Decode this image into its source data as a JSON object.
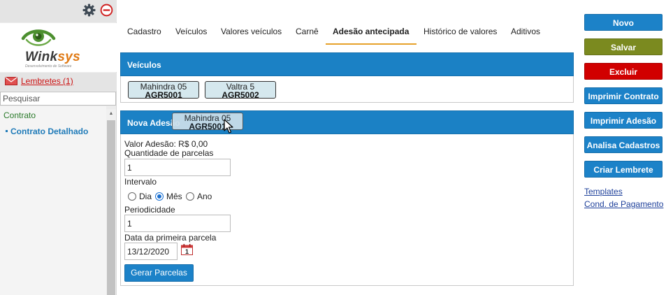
{
  "sidebar": {
    "logo": {
      "brand_prefix": "Wink",
      "brand_suffix": "sys",
      "tagline": "Desenvolvimento de Software"
    },
    "reminders_link": "Lembretes (1)",
    "search_placeholder": "Pesquisar",
    "nav_section": "Contrato",
    "nav_item": "Contrato Detalhado"
  },
  "tabs": [
    {
      "label": "Cadastro",
      "active": false
    },
    {
      "label": "Veículos",
      "active": false
    },
    {
      "label": "Valores veículos",
      "active": false
    },
    {
      "label": "Carnê",
      "active": false
    },
    {
      "label": "Adesão antecipada",
      "active": true
    },
    {
      "label": "Histórico de valores",
      "active": false
    },
    {
      "label": "Aditivos",
      "active": false
    }
  ],
  "vehicles_panel": {
    "title": "Veículos",
    "vehicles": [
      {
        "name": "Mahindra 05",
        "code": "AGR5001"
      },
      {
        "name": "Valtra 5",
        "code": "AGR5002"
      }
    ]
  },
  "adesao_panel": {
    "title": "Nova Adesão",
    "dragging_vehicle": {
      "name": "Mahindra 05",
      "code": "AGR5001"
    },
    "valor_adesao": "Valor Adesão: R$ 0,00",
    "parcelas_label": "Quantidade de parcelas",
    "parcelas_value": "1",
    "intervalo_label": "Intervalo",
    "intervalo_options": [
      "Dia",
      "Mês",
      "Ano"
    ],
    "intervalo_selected": "Mês",
    "periodicidade_label": "Periodicidade",
    "periodicidade_value": "1",
    "data_label": "Data da primeira parcela",
    "data_value": "13/12/2020",
    "calendar_day": "1",
    "gerar_button": "Gerar Parcelas"
  },
  "actions": {
    "novo": "Novo",
    "salvar": "Salvar",
    "excluir": "Excluir",
    "imprimir_contrato": "Imprimir Contrato",
    "imprimir_adesao": "Imprimir Adesão",
    "analisa_cadastros": "Analisa Cadastros",
    "criar_lembrete": "Criar Lembrete",
    "templates_link": "Templates",
    "cond_pagamento_link": "Cond. de Pagamento"
  },
  "colors": {
    "primary": "#1c82c8",
    "save": "#7b8a1f",
    "delete": "#d10000",
    "tab_underline": "#e6a12a",
    "brand_orange": "#e07a15",
    "brand_green": "#4c8f2f"
  }
}
